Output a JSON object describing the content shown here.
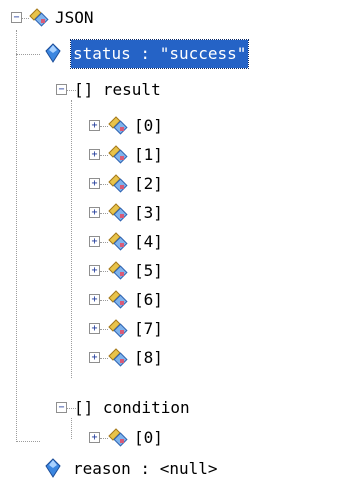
{
  "tree": {
    "root": {
      "label": "JSON",
      "toggle": "−",
      "status": {
        "text": "status : \"success\"",
        "selected": true
      },
      "result": {
        "label": "[] result",
        "toggle": "−",
        "items": [
          "[0]",
          "[1]",
          "[2]",
          "[3]",
          "[4]",
          "[5]",
          "[6]",
          "[7]",
          "[8]"
        ],
        "item_toggle": "+"
      },
      "condition": {
        "label": "[] condition",
        "toggle": "−",
        "items": [
          "[0]"
        ],
        "item_toggle": "+"
      },
      "reason": {
        "text": "reason : <null>"
      }
    }
  },
  "icons": {
    "object": "object-node-icon",
    "property": "property-value-icon"
  },
  "colors": {
    "selection_bg": "#2563c6",
    "selection_fg": "#ffffff",
    "tree_line": "#9c9c9c",
    "toggle_border": "#8f8f8f",
    "property_icon": "#1f5fbf"
  }
}
